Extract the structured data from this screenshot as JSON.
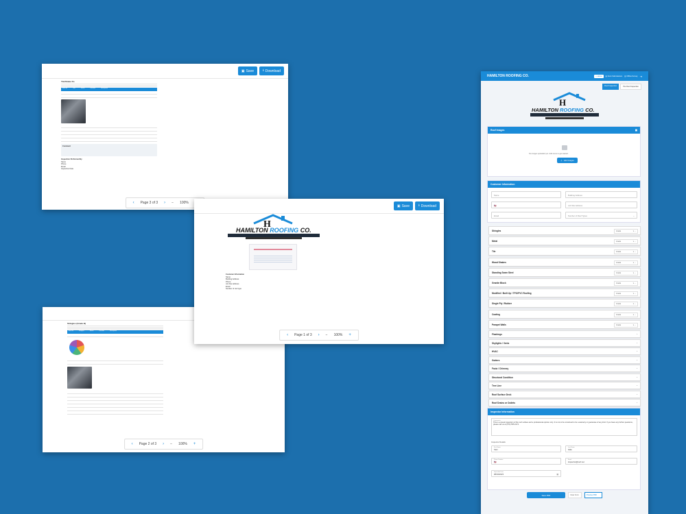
{
  "colors": {
    "background": "#1c6fad",
    "accent": "#1a8bd8"
  },
  "buttons": {
    "save": "Save",
    "download": "Download"
  },
  "viewer_top_left": {
    "page_label": "Page 3 of 3",
    "zoom": "100%",
    "minus": "−",
    "plus": "+",
    "prev": "‹",
    "next": "›"
  },
  "viewer_center": {
    "page_label": "Page 1 of 3",
    "zoom": "100%",
    "minus": "−",
    "plus": "+",
    "prev": "‹",
    "next": "›"
  },
  "viewer_bottom_left": {
    "page_label": "Page 2 of 3",
    "zoom": "100%",
    "minus": "−",
    "plus": "+",
    "prev": "‹",
    "next": "›"
  },
  "doc_page3": {
    "section": "Tile/Shake Do",
    "headers": [
      "Item No",
      "Title",
      "Status",
      "Location",
      "Description"
    ],
    "comments_title": "Comment",
    "inspector_title": "Inspection Performed By",
    "inspector_labels": [
      "Name",
      "Phone",
      "Email",
      "Inspection Date"
    ]
  },
  "doc_page2": {
    "section": "Shingles (Grade B)",
    "headers": [
      "Item No",
      "Shingles",
      "Status",
      "Location",
      "Description"
    ]
  },
  "doc_page1": {
    "customer_title": "Customer Information",
    "labels": [
      "Name",
      "Building Address",
      "Phone",
      "Job Site Address",
      "Email",
      "Number of roof type"
    ]
  },
  "logo": {
    "company_primary": "HAMILTON",
    "company_accent": "ROOFING",
    "company_suffix": "CO."
  },
  "app": {
    "title": "HAMILTON ROOFING CO.",
    "nav": [
      "Home",
      "Form Submissions",
      "Offline Survey"
    ],
    "tabs": [
      "Roof Inspection",
      "Tile Roof Inspection"
    ],
    "roof_images": {
      "title": "Roof Images",
      "hint": "No images uploaded yet. Add some to get started.",
      "add_label": "Add Images"
    },
    "customer": {
      "title": "Customer Information",
      "name": "Name",
      "building_address": "Building Address",
      "phone_code": "🇺🇸",
      "job_site": "Job Site Address",
      "email": "Email",
      "roof_type": "Number of Roof Types"
    },
    "grade_label": "Grade",
    "graded_rows": [
      "Shingles",
      "Metal",
      "Tile",
      "Wood Shakes",
      "Standing Seam Steel",
      "Granite Block",
      "Modified / Built Up / TPO/PVC Roofing",
      "Single Ply / Rubber",
      "Coating",
      "Parapet Walls"
    ],
    "other_rows": [
      "Flashings",
      "Skylights / Vents",
      "HVAC",
      "Gutters",
      "Facia / Chimney",
      "Structural Condition",
      "Tree Line",
      "Roof Surface Deck",
      "Roof Drains or Outlets"
    ],
    "inspector": {
      "title": "Inspector Information",
      "comment_label": "Comments",
      "comment": "This is a visual inspection of the roof surface and a professional opinion only. It is not to be construed to be a warranty or guarantee of any kind. If you have any further questions, please call us at (570) 555-0174.",
      "details_label": "Inspector Details",
      "first_name_label": "First Name",
      "first_name": "Sam",
      "last_name_label": "Last Name",
      "last_name": "Hale",
      "phone_label": "Phone Number",
      "email_label": "Email",
      "email": "inspector@roof.net",
      "date_label": "Inspection Date",
      "date": "08/04/2023"
    },
    "footer_buttons": [
      "Save PDF",
      "Clear Form",
      "Preview PDF"
    ]
  }
}
